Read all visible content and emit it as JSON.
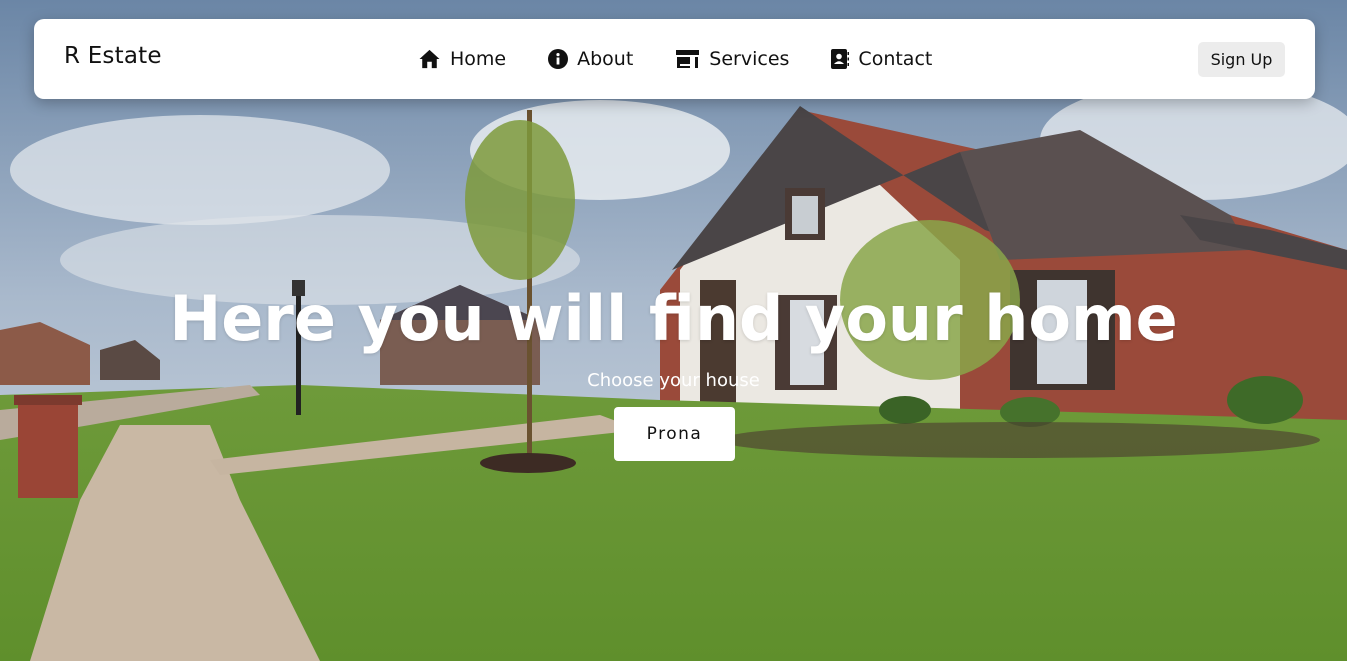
{
  "brand": {
    "name": "R Estate"
  },
  "nav": {
    "items": [
      {
        "label": "Home",
        "icon": "home-icon"
      },
      {
        "label": "About",
        "icon": "info-icon"
      },
      {
        "label": "Services",
        "icon": "store-icon"
      },
      {
        "label": "Contact",
        "icon": "contact-card-icon"
      }
    ],
    "signup_label": "Sign Up"
  },
  "hero": {
    "title": "Here you will find your home",
    "subtitle": "Choose your house",
    "cta_label": "Prona",
    "background": "house-with-lawn-photo"
  },
  "colors": {
    "navbar_bg": "#ffffff",
    "signup_bg": "#ececec",
    "text_dark": "#111111",
    "hero_text": "#ffffff"
  }
}
